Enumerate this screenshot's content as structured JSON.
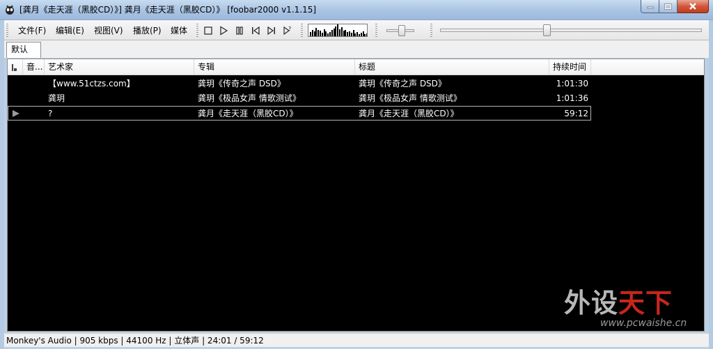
{
  "window": {
    "title": "[龚月《走天涯（黑胶CD）》] 龚月《走天涯（黑胶CD）》   [foobar2000 v1.1.15]"
  },
  "menu": {
    "items": [
      {
        "label": "文件(F)"
      },
      {
        "label": "编辑(E)"
      },
      {
        "label": "视图(V)"
      },
      {
        "label": "播放(P)"
      },
      {
        "label": "媒体"
      }
    ]
  },
  "playback": {
    "volume_level": 0.55,
    "seek_position": 0.407,
    "visualizer_levels": [
      0.35,
      0.55,
      0.4,
      0.7,
      0.5,
      0.45,
      0.3,
      0.6,
      0.4,
      0.25,
      0.35,
      0.5,
      0.65,
      0.8,
      1.0,
      0.6,
      0.75,
      0.45,
      0.55,
      0.35,
      0.4,
      0.3,
      0.5,
      0.25,
      0.35,
      0.2,
      0.3,
      0.4,
      0.15,
      0.25
    ]
  },
  "tabs": [
    {
      "label": "默认",
      "active": true
    }
  ],
  "playlist": {
    "columns": [
      "",
      "音...",
      "艺术家",
      "专辑",
      "标题",
      "持续时间"
    ],
    "rows": [
      {
        "artist": "【www.51ctzs.com】",
        "album": "龚玥《传奇之声 DSD》",
        "title": "龚玥《传奇之声 DSD》",
        "duration": "1:01:30",
        "playing": false
      },
      {
        "artist": "龚玥",
        "album": "龚玥《极品女声 情歌测试》",
        "title": "龚玥《极品女声 情歌测试》",
        "duration": "1:01:36",
        "playing": false
      },
      {
        "artist": "?",
        "album": "龚月《走天涯（黑胶CD）》",
        "title": "龚月《走天涯（黑胶CD）》",
        "duration": "59:12",
        "playing": true
      }
    ]
  },
  "status": {
    "text": "Monkey's Audio | 905 kbps | 44100 Hz | 立体声 | 24:01 / 59:12"
  },
  "watermark": {
    "main_a": "外设",
    "main_b": "天下",
    "sub": "www.pcwaishe.cn"
  },
  "colors": {
    "playlist_bg": "#000000",
    "playlist_text": "#ffffff",
    "watermark_red": "#c8261c"
  }
}
